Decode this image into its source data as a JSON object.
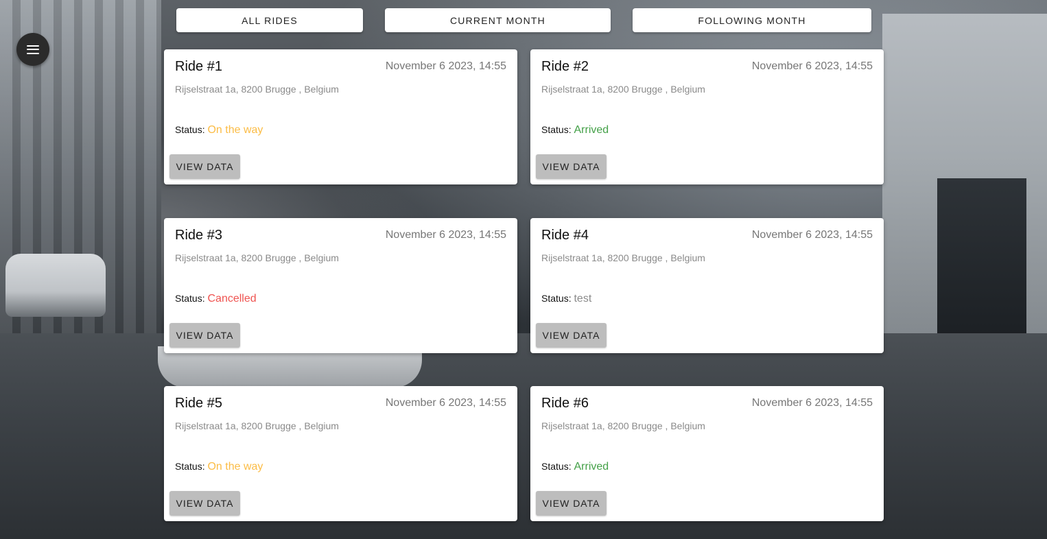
{
  "nav": {
    "menu_icon": "hamburger-menu-icon"
  },
  "filters": [
    {
      "label": "ALL RIDES"
    },
    {
      "label": "CURRENT MONTH"
    },
    {
      "label": "FOLLOWING MONTH"
    }
  ],
  "status_label": "Status:",
  "colors": {
    "on_the_way": "#fbbc45",
    "arrived": "#43a047",
    "cancelled": "#ef5350",
    "test": "#8a8a8a"
  },
  "rides": [
    {
      "title": "Ride #1",
      "date": "November 6 2023, 14:55",
      "address": "Rijselstraat 1a, 8200 Brugge , Belgium",
      "status": "On the way",
      "status_color": "#fbbc45",
      "button": "VIEW DATA"
    },
    {
      "title": "Ride #2",
      "date": "November 6 2023, 14:55",
      "address": "Rijselstraat 1a, 8200 Brugge , Belgium",
      "status": "Arrived",
      "status_color": "#43a047",
      "button": "VIEW DATA"
    },
    {
      "title": "Ride #3",
      "date": "November 6 2023, 14:55",
      "address": "Rijselstraat 1a, 8200 Brugge , Belgium",
      "status": "Cancelled",
      "status_color": "#ef5350",
      "button": "VIEW DATA"
    },
    {
      "title": "Ride #4",
      "date": "November 6 2023, 14:55",
      "address": "Rijselstraat 1a, 8200 Brugge , Belgium",
      "status": "test",
      "status_color": "#8a8a8a",
      "button": "VIEW DATA"
    },
    {
      "title": "Ride #5",
      "date": "November 6 2023, 14:55",
      "address": "Rijselstraat 1a, 8200 Brugge , Belgium",
      "status": "On the way",
      "status_color": "#fbbc45",
      "button": "VIEW DATA"
    },
    {
      "title": "Ride #6",
      "date": "November 6 2023, 14:55",
      "address": "Rijselstraat 1a, 8200 Brugge , Belgium",
      "status": "Arrived",
      "status_color": "#43a047",
      "button": "VIEW DATA"
    }
  ]
}
